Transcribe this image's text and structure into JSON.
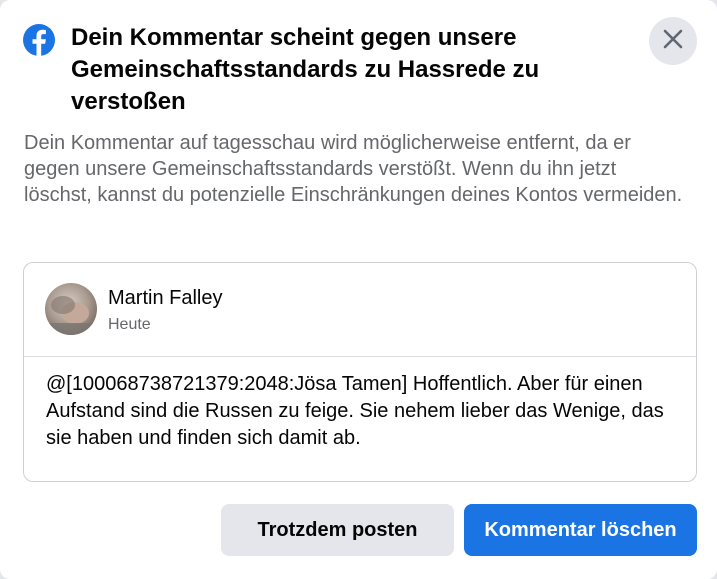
{
  "dialog": {
    "logo_icon": "facebook-logo-icon",
    "title": "Dein Kommentar scheint gegen unsere Gemeinschaftsstandards zu Hassrede zu verstoßen",
    "close_icon": "close-icon",
    "description": "Dein Kommentar auf tagesschau wird möglicherweise entfernt, da er gegen unsere Gemeinschaftsstandards verstößt. Wenn du ihn jetzt löschst, kannst du potenzielle Einschränkungen deines Kontos vermeiden."
  },
  "comment": {
    "author": "Martin Falley",
    "time": "Heute",
    "text": "@[100068738721379:2048:Jösa Tamen] Hoffentlich. Aber für einen Aufstand sind die Russen zu feige. Sie nehem lieber das Wenige, das sie haben und finden sich damit ab."
  },
  "actions": {
    "post_anyway": "Trotzdem posten",
    "delete_comment": "Kommentar löschen"
  },
  "colors": {
    "brand": "#1b74e4",
    "secondary_button": "#e4e6eb",
    "muted_text": "#65676b"
  }
}
